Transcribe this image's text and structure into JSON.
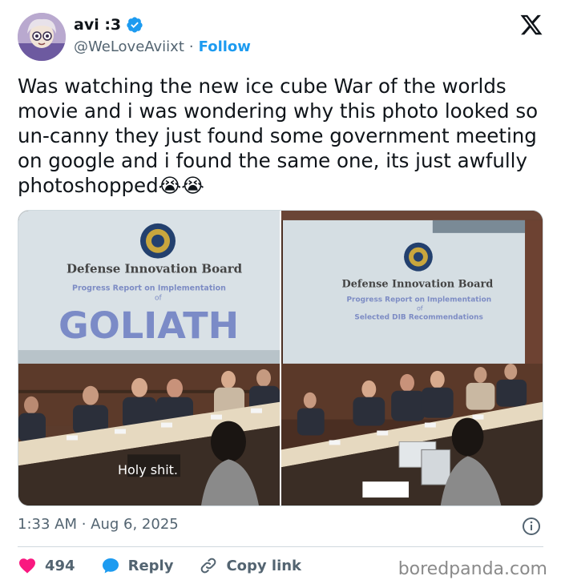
{
  "author": {
    "display_name": "avi :3",
    "handle": "@WeLoveAviixt",
    "separator": "·",
    "follow_label": "Follow"
  },
  "tweet": {
    "text": "Was watching the new ice cube War of the worlds movie and i was wondering why this photo looked so un-canny they just found some government meeting on google and i found the same one, its just awfully photoshopped😭😭",
    "timestamp": "1:33 AM · Aug 6, 2025"
  },
  "media": {
    "left": {
      "org": "Defense Innovation Board",
      "subtitle": "Progress Report on Implementation",
      "of": "of",
      "big_word": "GOLIATH",
      "caption": "Holy shit."
    },
    "right": {
      "org": "Defense Innovation Board",
      "subtitle": "Progress Report on Implementation",
      "of": "of",
      "line3": "Selected DIB Recommendations"
    }
  },
  "actions": {
    "like_count": "494",
    "reply_label": "Reply",
    "copy_label": "Copy link"
  },
  "watermark": "boredpanda.com",
  "colors": {
    "accent": "#1d9bf0",
    "like": "#f91880",
    "text": "#0f1419",
    "muted": "#536471"
  }
}
